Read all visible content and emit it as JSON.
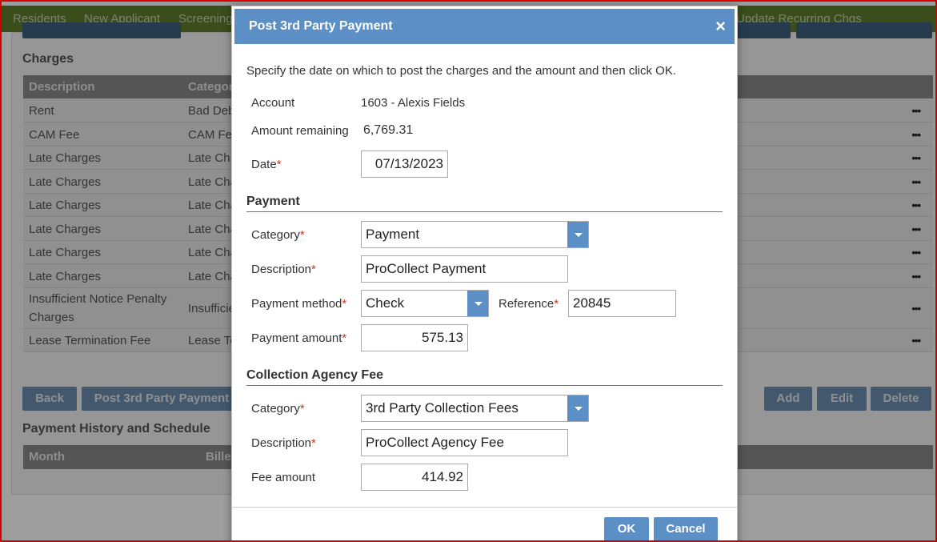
{
  "nav": {
    "items": [
      "Residents",
      "New Applicant",
      "Screening",
      "Update Recurring Chgs"
    ]
  },
  "charges": {
    "title": "Charges",
    "columns": [
      "Description",
      "Category"
    ],
    "rows": [
      {
        "description": "Rent",
        "category": "Bad Deb"
      },
      {
        "description": "CAM Fee",
        "category": "CAM Fe"
      },
      {
        "description": "Late Charges",
        "category": "Late Ch"
      },
      {
        "description": "Late Charges",
        "category": "Late Cha"
      },
      {
        "description": "Late Charges",
        "category": "Late Cha"
      },
      {
        "description": "Late Charges",
        "category": "Late Cha"
      },
      {
        "description": "Late Charges",
        "category": "Late Cha"
      },
      {
        "description": "Late Charges",
        "category": "Late Cha"
      },
      {
        "description": "Insufficient Notice Penalty Charges",
        "category": "Insufficie"
      },
      {
        "description": "Lease Termination Fee",
        "category": "Lease Te"
      }
    ],
    "row_menu_glyph": "•••"
  },
  "actions": {
    "back": "Back",
    "post_3rd_party": "Post 3rd Party Payment",
    "add": "Add",
    "edit": "Edit",
    "delete": "Delete"
  },
  "history": {
    "title": "Payment History and Schedule",
    "columns": [
      "Month",
      "Bille"
    ]
  },
  "modal": {
    "title": "Post 3rd Party Payment",
    "close_glyph": "×",
    "instructions": "Specify the date on which to post the charges and the amount and then click OK.",
    "account_label": "Account",
    "account_value": "1603 - Alexis Fields",
    "amount_remaining_label": "Amount remaining",
    "amount_remaining_value": "6,769.31",
    "date_label": "Date",
    "date_value": "07/13/2023",
    "required_mark": "*",
    "payment": {
      "section_title": "Payment",
      "category_label": "Category",
      "category_value": "Payment",
      "description_label": "Description",
      "description_value": "ProCollect Payment",
      "method_label": "Payment method",
      "method_value": "Check",
      "reference_label": "Reference",
      "reference_value": "20845",
      "amount_label": "Payment amount",
      "amount_value": "575.13"
    },
    "fee": {
      "section_title": "Collection Agency Fee",
      "category_label": "Category",
      "category_value": "3rd Party Collection Fees",
      "description_label": "Description",
      "description_value": "ProCollect Agency Fee",
      "amount_label": "Fee amount",
      "amount_value": "414.92"
    },
    "ok": "OK",
    "cancel": "Cancel"
  },
  "colors": {
    "accent": "#5b8fc6",
    "nav_bg": "#5f7d2c",
    "required": "#c0392b",
    "frame_border": "#d40000"
  }
}
